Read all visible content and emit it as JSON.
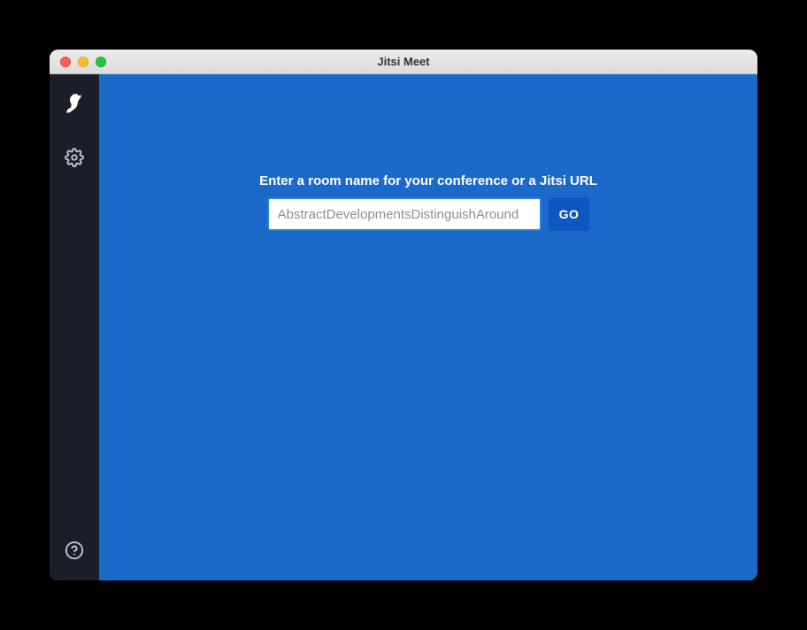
{
  "window": {
    "title": "Jitsi Meet"
  },
  "main": {
    "prompt": "Enter a room name for your conference or a Jitsi URL",
    "room_placeholder": "AbstractDevelopmentsDistinguishAround",
    "go_label": "GO"
  }
}
